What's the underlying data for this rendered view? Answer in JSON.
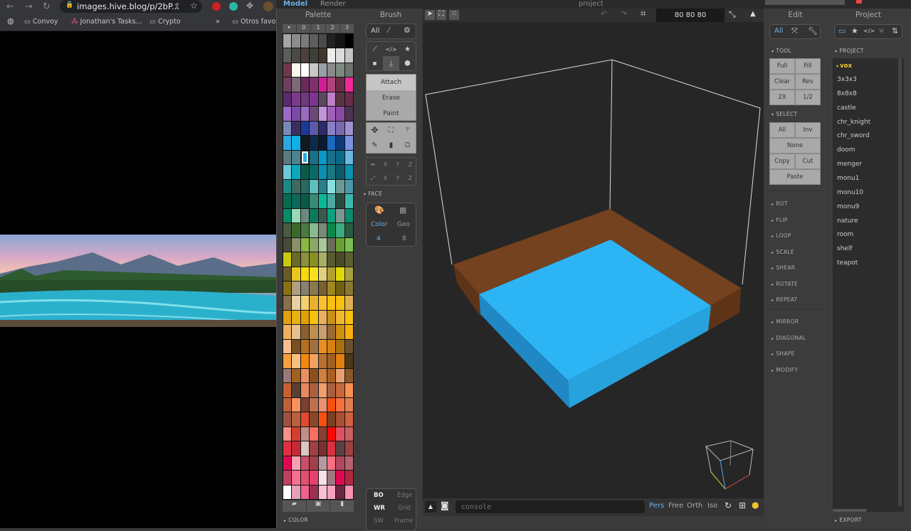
{
  "browser": {
    "url": "images.hive.blog/p/2bP...",
    "bookmarks": [
      "Convoy",
      "Jonathan's Tasks...",
      "Crypto",
      "Otros favo"
    ]
  },
  "app": {
    "tabs": [
      "Model",
      "Render"
    ],
    "project_title": "project"
  },
  "palette": {
    "title": "Palette",
    "tabs": [
      "▸",
      "0",
      "1",
      "2",
      "3"
    ],
    "selected": "#2ab0e0",
    "rows": [
      [
        "#a6a6a6",
        "#8c8c8c",
        "#7a7a7a",
        "#5e5e5e",
        "#4a4a4a",
        "#222222",
        "#151515",
        "#000000"
      ],
      [
        "#5a5f5a",
        "#4a4a44",
        "#4e3f3a",
        "#3c4038",
        "#42372c",
        "#ececec",
        "#dcdcdc",
        "#c4c4c4"
      ],
      [
        "#6e3a4a",
        "#fbf6ee",
        "#ffffff",
        "#c7c7c7",
        "#9aa0a8",
        "#8a8a8a",
        "#7c8a82",
        "#6f7470"
      ],
      [
        "#6e3f5e",
        "#7c6878",
        "#6a2a5a",
        "#80306e",
        "#d01e96",
        "#b0447a",
        "#6a2e44",
        "#f0289a"
      ],
      [
        "#5a2a6e",
        "#7c3a8e",
        "#6e3a7e",
        "#7e3490",
        "#5a4a5e",
        "#c080c8",
        "#5a3444",
        "#6a2a4a"
      ],
      [
        "#9a6ac4",
        "#7a4aa8",
        "#9a6ac0",
        "#6a4878",
        "#c096d8",
        "#a060b8",
        "#8a4aa0",
        "#4a3450"
      ],
      [
        "#7a88b8",
        "#3a2e60",
        "#1a3a9a",
        "#5a5aa8",
        "#2e2a6a",
        "#8a80c8",
        "#7a6ab0",
        "#a090d0"
      ],
      [
        "#2aa8e0",
        "#10b0e8",
        "#141820",
        "#0e2a4a",
        "#0a1a30",
        "#1a6ac0",
        "#0e3a7a",
        "#7a90e0"
      ],
      [
        "#5a7a82",
        "#4a8490",
        "#2ab0e0",
        "#1a7088",
        "#0a98c8",
        "#1a7088",
        "#0a6a8a",
        "#6ab8e0"
      ],
      [
        "#6ac8d8",
        "#0aa8b8",
        "#0a5a4a",
        "#0a6a6a",
        "#0a90b0",
        "#1a7880",
        "#0a5a6a",
        "#0a90b0"
      ],
      [
        "#1a8a88",
        "#3a6a60",
        "#2a6a60",
        "#5ac0c0",
        "#2a8088",
        "#8ae0e0",
        "#6a9a98",
        "#4a9aa8"
      ],
      [
        "#0a6a50",
        "#0a6a58",
        "#0a5a48",
        "#3a8a78",
        "#0ab898",
        "#4aa8a0",
        "#2a4a40",
        "#3ab8b0"
      ],
      [
        "#0a8a68",
        "#9ad8b8",
        "#6a8a80",
        "#0a7a5a",
        "#3a5a50",
        "#0aa080",
        "#7a9890",
        "#0a8a70"
      ],
      [
        "#4a5a40",
        "#3a6a2a",
        "#4a7a40",
        "#8ab890",
        "#7a8a78",
        "#0a8a48",
        "#3aaa80",
        "#2a5a40"
      ],
      [
        "#4a4a38",
        "#8a9068",
        "#8ab840",
        "#8aa868",
        "#a8c898",
        "#6a6a5a",
        "#6aa030",
        "#7ac050"
      ],
      [
        "#c8c810",
        "#6a6a28",
        "#8a9040",
        "#8a9020",
        "#a8b068",
        "#5a5a30",
        "#4a4a28",
        "#5a6030"
      ],
      [
        "#6a5a28",
        "#e8c820",
        "#f8d810",
        "#f8e020",
        "#e0d080",
        "#b0a030",
        "#e0d808",
        "#a8a040"
      ],
      [
        "#8a7010",
        "#b0a080",
        "#8a8070",
        "#8a7850",
        "#786030",
        "#a08820",
        "#706010",
        "#8a7830"
      ],
      [
        "#8a7048",
        "#e8d0a0",
        "#f8d070",
        "#e8b030",
        "#f8c030",
        "#f8c010",
        "#f8c010",
        "#e0b050"
      ],
      [
        "#e0a010",
        "#e8b010",
        "#e0a008",
        "#f8c010",
        "#e8b060",
        "#c89018",
        "#f0b830",
        "#f8c010"
      ],
      [
        "#f0b060",
        "#e8c090",
        "#8a6030",
        "#c09050",
        "#c8a070",
        "#9a6a30",
        "#d09010",
        "#f8b010"
      ],
      [
        "#f8c090",
        "#7a5020",
        "#b87020",
        "#a07040",
        "#e89020",
        "#d88010",
        "#a87010",
        "#6a5030"
      ],
      [
        "#f8a040",
        "#f8c080",
        "#f08810",
        "#f0a060",
        "#b87030",
        "#a06020",
        "#e08010",
        "#4a3818"
      ],
      [
        "#9a7a78",
        "#a06020",
        "#e89060",
        "#8a5020",
        "#d08040",
        "#a86020",
        "#e8a070",
        "#8a5828"
      ],
      [
        "#c86030",
        "#5a4030",
        "#e88860",
        "#a86040",
        "#f0a070",
        "#a86040",
        "#c86838",
        "#f89050"
      ],
      [
        "#c06038",
        "#f89060",
        "#7a4030",
        "#c07050",
        "#e89070",
        "#f85010",
        "#f87040",
        "#e08050"
      ],
      [
        "#a05040",
        "#b86040",
        "#e04830",
        "#8a4828",
        "#f85010",
        "#7a4020",
        "#a85030",
        "#d06040"
      ],
      [
        "#f89088",
        "#d04030",
        "#c09088",
        "#f87060",
        "#8a4030",
        "#f80808",
        "#e05060",
        "#c86060"
      ],
      [
        "#e03040",
        "#c82838",
        "#d8c8c0",
        "#a04040",
        "#7a3030",
        "#d83040",
        "#5a4040",
        "#a04040"
      ],
      [
        "#e00850",
        "#f8a0b0",
        "#c85068",
        "#a04048",
        "#b898a0",
        "#f87080",
        "#b04860",
        "#b86070"
      ],
      [
        "#c04060",
        "#f87090",
        "#e05070",
        "#e84070",
        "#f8e0e8",
        "#a07880",
        "#e00850",
        "#b02840"
      ],
      [
        "#ffffff",
        "#e8a0b8",
        "#f06090",
        "#a03050",
        "#f8c0d0",
        "#f8a0c0",
        "#6a2840",
        "#f890b0"
      ]
    ],
    "footer_icons": [
      "folder-open-icon",
      "save-icon",
      "file-icon"
    ],
    "color_section": "COLOR"
  },
  "brush": {
    "title": "Brush",
    "filter": "All",
    "modes": [
      "Attach",
      "Erase",
      "Paint"
    ],
    "active_mode": "Attach",
    "axis_rows": [
      [
        "X",
        "Y",
        "Z"
      ],
      [
        "X",
        "Y",
        "Z"
      ]
    ],
    "face": {
      "label": "FACE",
      "color_label": "Color",
      "geo_label": "Geo",
      "color_value": "4",
      "geo_value": "8"
    },
    "render_opts": [
      [
        "BO",
        "Edge"
      ],
      [
        "WR",
        "Grid"
      ],
      [
        "SW",
        "Frame"
      ]
    ]
  },
  "viewport": {
    "size": "80 80 80",
    "console_placeholder": "console",
    "views": [
      "Pers",
      "Free",
      "Orth",
      "Iso"
    ],
    "active_view": "Pers",
    "colors": {
      "base": "#6f3f22",
      "water": "#2db4f4",
      "accent": "#6ab0e8"
    }
  },
  "edit": {
    "title": "Edit",
    "filter": "All",
    "tool_label": "TOOL",
    "tool_buttons": [
      "Full",
      "Fill",
      "Clear",
      "Rev",
      "2X",
      "1/2"
    ],
    "select_label": "SELECT",
    "select_buttons": [
      "All",
      "Inv",
      "None",
      "Copy",
      "Cut",
      "Paste"
    ],
    "sections": [
      "ROT",
      "FLIP",
      "LOOP",
      "SCALE",
      "SHEAR",
      "ROTATE",
      "REPEAT"
    ],
    "sections2": [
      "MIRROR",
      "DIAGONAL",
      "SHAPE",
      "MODIFY"
    ]
  },
  "project": {
    "title": "Project",
    "section": "PROJECT",
    "folder": "vox",
    "items": [
      "3x3x3",
      "8x8x8",
      "castle",
      "chr_knight",
      "chr_sword",
      "doom",
      "menger",
      "monu1",
      "monu10",
      "monu9",
      "nature",
      "room",
      "shelf",
      "teapot"
    ],
    "export_label": "EXPORT"
  }
}
